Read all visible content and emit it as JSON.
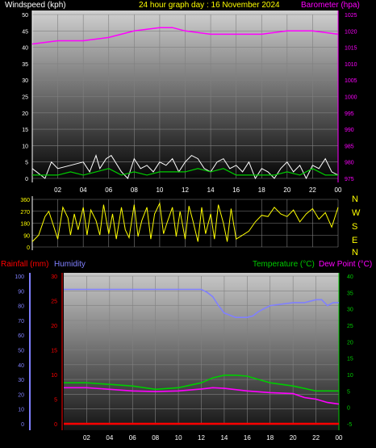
{
  "header": {
    "windspeed_label": "Windspeed (kph)",
    "title": "24 hour graph day : 16 November 2024",
    "barometer_label": "Barometer (hpa)"
  },
  "mid": {
    "compass_letters": [
      "N",
      "W",
      "S",
      "E",
      "N"
    ]
  },
  "lower_header": {
    "rainfall_label": "Rainfall (mm)",
    "humidity_label": "Humidity",
    "temperature_label": "Temperature (°C)",
    "dewpoint_label": "Dew Point (°C)"
  },
  "colors": {
    "title": "#ffff00",
    "windspeed_label": "#ffffff",
    "barometer": "#ff00ff",
    "wind_gust": "#ffffff",
    "wind_avg": "#00cc00",
    "direction": "#ffff00",
    "rainfall": "#ff0000",
    "humidity": "#8080ff",
    "temperature": "#00cc00",
    "dewpoint": "#ff00ff",
    "grid": "#808080"
  },
  "chart_data": [
    {
      "type": "line",
      "name": "wind-barometer",
      "x_ticks": [
        "02",
        "04",
        "06",
        "08",
        "10",
        "12",
        "14",
        "16",
        "18",
        "20",
        "22",
        "00"
      ],
      "y_left_ticks": [
        "0",
        "5",
        "10",
        "15",
        "20",
        "25",
        "30",
        "35",
        "40",
        "45",
        "50"
      ],
      "y_left_range": [
        0,
        50
      ],
      "y_right_ticks": [
        "975",
        "980",
        "985",
        "990",
        "995",
        "1000",
        "1005",
        "1010",
        "1015",
        "1020",
        "1025"
      ],
      "y_right_range": [
        975,
        1025
      ],
      "series": [
        {
          "name": "Barometer (hpa)",
          "axis": "right",
          "hours": [
            0,
            2,
            4,
            6,
            8,
            10,
            11,
            12,
            14,
            16,
            18,
            20,
            22,
            24
          ],
          "values": [
            1016,
            1017,
            1017,
            1018,
            1020,
            1021,
            1021,
            1020,
            1019,
            1019,
            1019,
            1020,
            1020,
            1019
          ]
        },
        {
          "name": "Windspeed (kph)",
          "axis": "left",
          "gust_hours": [
            0,
            1,
            1.5,
            2,
            3,
            4,
            4.5,
            5,
            5.3,
            5.8,
            6.2,
            7,
            7.5,
            8,
            8.5,
            9,
            9.5,
            10,
            10.5,
            11,
            11.5,
            12,
            12.5,
            13,
            13.5,
            14,
            14.5,
            15,
            15.5,
            16,
            16.5,
            17,
            17.5,
            18,
            18.5,
            19,
            19.5,
            20,
            20.5,
            21,
            21.5,
            22,
            22.5,
            23,
            23.5,
            24
          ],
          "gust": [
            3,
            0,
            5,
            3,
            4,
            5,
            2,
            7,
            3,
            6,
            7,
            2,
            0,
            6,
            3,
            4,
            2,
            5,
            4,
            6,
            2,
            5,
            7,
            6,
            3,
            2,
            5,
            6,
            3,
            4,
            2,
            5,
            0,
            3,
            2,
            0,
            3,
            5,
            2,
            4,
            0,
            4,
            3,
            6,
            2,
            1
          ],
          "avg_hours": [
            0,
            1,
            2,
            3,
            4,
            5,
            6,
            7,
            8,
            9,
            10,
            11,
            12,
            13,
            14,
            15,
            16,
            17,
            18,
            19,
            20,
            21,
            22,
            23,
            24
          ],
          "avg": [
            1,
            1,
            1,
            2,
            1,
            2,
            3,
            1,
            2,
            1,
            2,
            2,
            2,
            3,
            2,
            3,
            1,
            1,
            1,
            1,
            2,
            1,
            3,
            1,
            1
          ]
        }
      ]
    },
    {
      "type": "line",
      "name": "wind-direction",
      "x_ticks": [
        "02",
        "04",
        "06",
        "08",
        "10",
        "12",
        "14",
        "16",
        "18",
        "20",
        "22",
        "00"
      ],
      "y_ticks": [
        "0",
        "90",
        "180",
        "270",
        "360"
      ],
      "y_range": [
        0,
        360
      ],
      "series": [
        {
          "name": "Wind direction",
          "hours": [
            0,
            0.5,
            1,
            1.3,
            1.6,
            2,
            2.4,
            2.8,
            3,
            3.3,
            3.6,
            4,
            4.3,
            4.6,
            5,
            5.3,
            5.6,
            6,
            6.3,
            6.6,
            7,
            7.3,
            7.6,
            8,
            8.3,
            8.6,
            9,
            9.3,
            9.6,
            10,
            10.3,
            10.6,
            11,
            11.3,
            11.6,
            12,
            12.3,
            12.6,
            13,
            13.3,
            13.6,
            14,
            14.3,
            14.6,
            15,
            15.3,
            15.6,
            16,
            16.5,
            17,
            17.5,
            18,
            18.5,
            19,
            19.5,
            20,
            20.5,
            21,
            21.5,
            22,
            22.5,
            23,
            23.5,
            24
          ],
          "values": [
            40,
            90,
            230,
            270,
            180,
            60,
            300,
            220,
            90,
            250,
            130,
            300,
            90,
            280,
            200,
            90,
            320,
            100,
            250,
            60,
            300,
            130,
            70,
            320,
            80,
            200,
            300,
            60,
            250,
            330,
            100,
            190,
            300,
            80,
            270,
            60,
            310,
            200,
            40,
            300,
            100,
            250,
            60,
            320,
            180,
            40,
            290,
            60,
            90,
            120,
            190,
            240,
            230,
            300,
            250,
            230,
            280,
            190,
            250,
            290,
            210,
            260,
            150,
            300
          ]
        }
      ]
    },
    {
      "type": "line",
      "name": "temperature-humidity",
      "x_ticks": [
        "02",
        "04",
        "06",
        "08",
        "10",
        "12",
        "14",
        "16",
        "18",
        "20",
        "22",
        "00"
      ],
      "y_humidity_ticks": [
        "0",
        "10",
        "20",
        "30",
        "40",
        "50",
        "60",
        "70",
        "80",
        "90",
        "100"
      ],
      "y_humidity_range": [
        0,
        100
      ],
      "y_rain_ticks": [
        "0",
        "5",
        "10",
        "15",
        "20",
        "25",
        "30"
      ],
      "y_rain_range": [
        0,
        30
      ],
      "y_temp_ticks": [
        "-5",
        "0",
        "5",
        "10",
        "15",
        "20",
        "25",
        "30",
        "35",
        "40"
      ],
      "y_temp_range": [
        -5,
        40
      ],
      "series": [
        {
          "name": "Humidity",
          "axis": "humidity",
          "hours": [
            0,
            4,
            8,
            12,
            12.5,
            13,
            13.5,
            14,
            15,
            16,
            16.5,
            17,
            18,
            20,
            21,
            22,
            22.5,
            23,
            23.5,
            24
          ],
          "values": [
            91,
            91,
            91,
            91,
            89,
            86,
            80,
            75,
            72,
            72,
            73,
            76,
            80,
            82,
            82,
            84,
            84,
            80,
            82,
            82
          ]
        },
        {
          "name": "Temperature (°C)",
          "axis": "temp",
          "hours": [
            0,
            2,
            4,
            6,
            8,
            10,
            12,
            13,
            14,
            15,
            16,
            17,
            18,
            20,
            22,
            24
          ],
          "values": [
            7.5,
            7.5,
            7,
            6.5,
            5.5,
            6,
            7.5,
            9,
            9.8,
            9.8,
            9.5,
            8.5,
            7.5,
            6.5,
            5,
            5
          ]
        },
        {
          "name": "Dew Point (°C)",
          "axis": "temp",
          "hours": [
            0,
            2,
            4,
            6,
            8,
            10,
            12,
            13,
            14,
            15,
            16,
            18,
            20,
            21,
            22,
            23,
            24
          ],
          "values": [
            6,
            6,
            5.5,
            5,
            4.8,
            5,
            5.6,
            6,
            5.8,
            5.4,
            5,
            4.5,
            4.2,
            3,
            2.5,
            1.5,
            1
          ]
        },
        {
          "name": "Rainfall (mm)",
          "axis": "rain",
          "hours": [
            0,
            24
          ],
          "values": [
            0,
            0
          ]
        }
      ]
    }
  ]
}
